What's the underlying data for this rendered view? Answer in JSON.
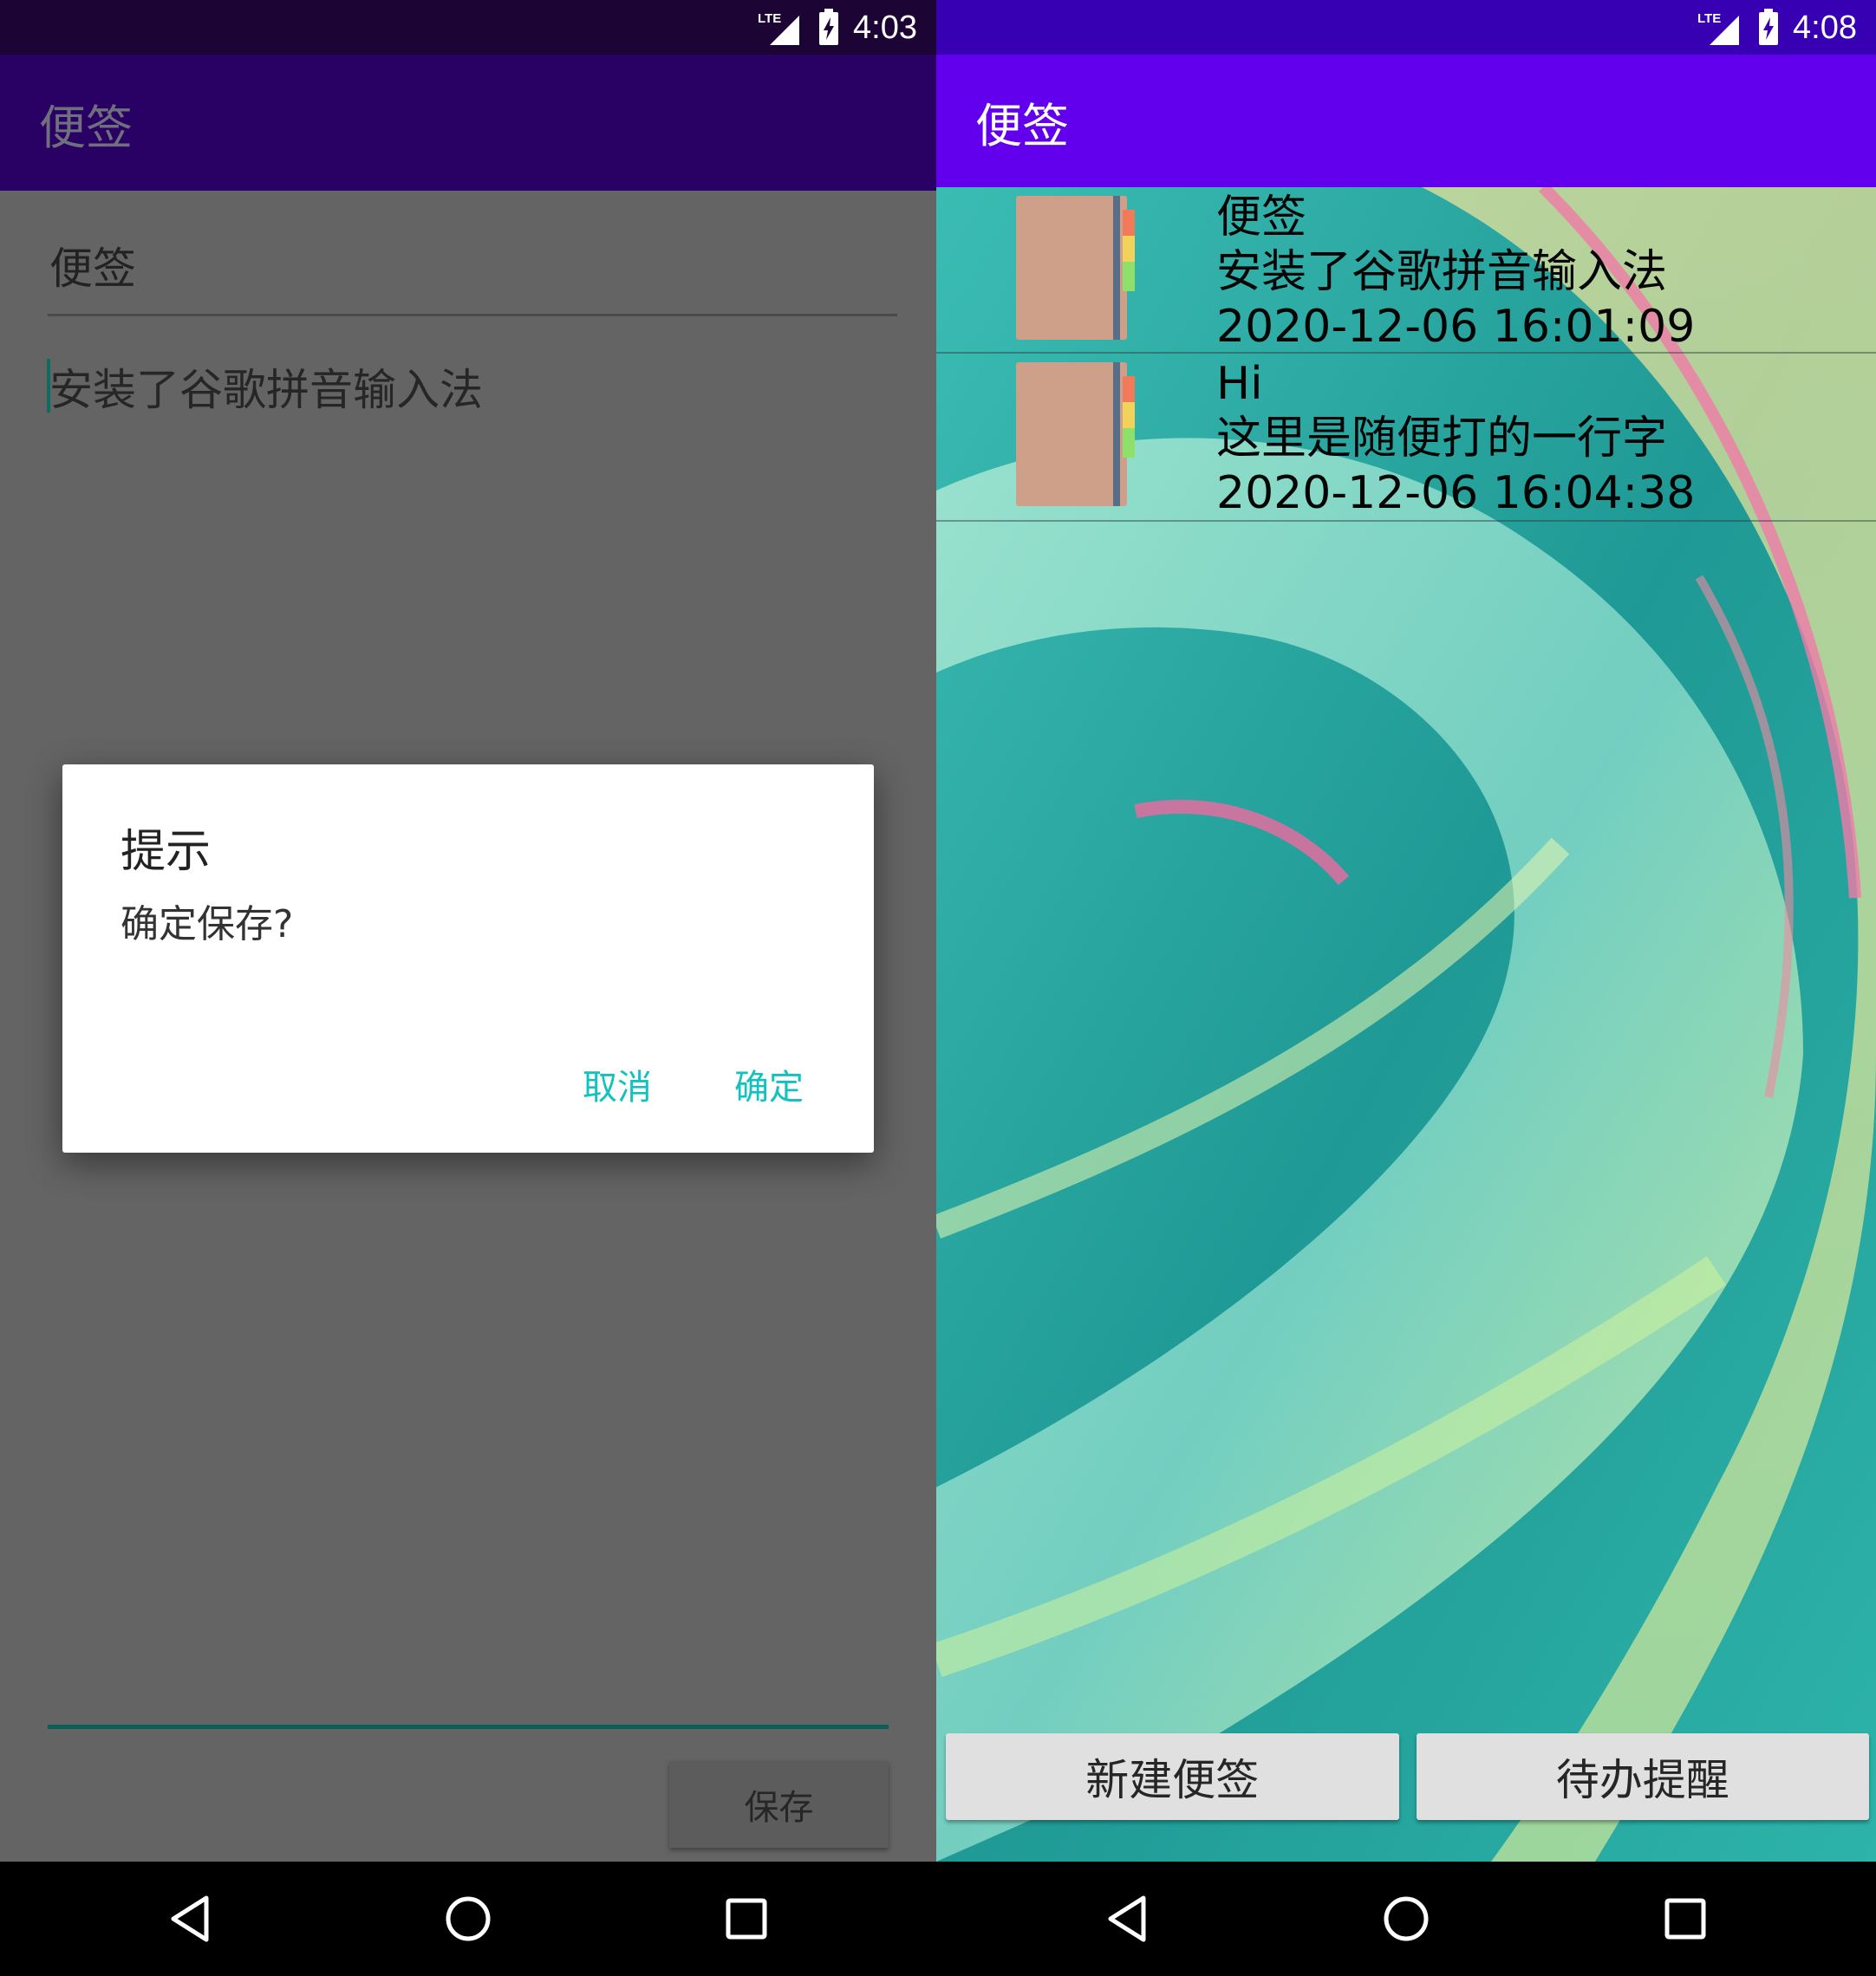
{
  "left_screen": {
    "status": {
      "time": "4:03",
      "network": "LTE"
    },
    "app_title": "便签",
    "note_title": "便签",
    "note_body": "安装了谷歌拼音输入法",
    "save_label": "保存",
    "dialog": {
      "title": "提示",
      "message": "确定保存?",
      "cancel_label": "取消",
      "ok_label": "确定",
      "button_color": "#12c2bf"
    },
    "colors": {
      "appbar": "#290064",
      "statusbar": "#1c0535",
      "scrim_background": "#646464"
    }
  },
  "right_screen": {
    "status": {
      "time": "4:08",
      "network": "LTE"
    },
    "app_title": "便签",
    "notes": [
      {
        "title": "便签",
        "content": "安装了谷歌拼音输入法",
        "time": "2020-12-06 16:01:09",
        "icon": "notebook-icon"
      },
      {
        "title": "Hi",
        "content": "这里是随便打的一行字",
        "time": "2020-12-06 16:04:38",
        "icon": "notebook-icon"
      }
    ],
    "buttons": {
      "new_note": "新建便签",
      "todo_reminder": "待办提醒"
    },
    "colors": {
      "appbar": "#6200ee",
      "statusbar": "#3700b3"
    }
  },
  "navigation": {
    "icons": [
      "back-icon",
      "home-icon",
      "recents-icon"
    ]
  }
}
